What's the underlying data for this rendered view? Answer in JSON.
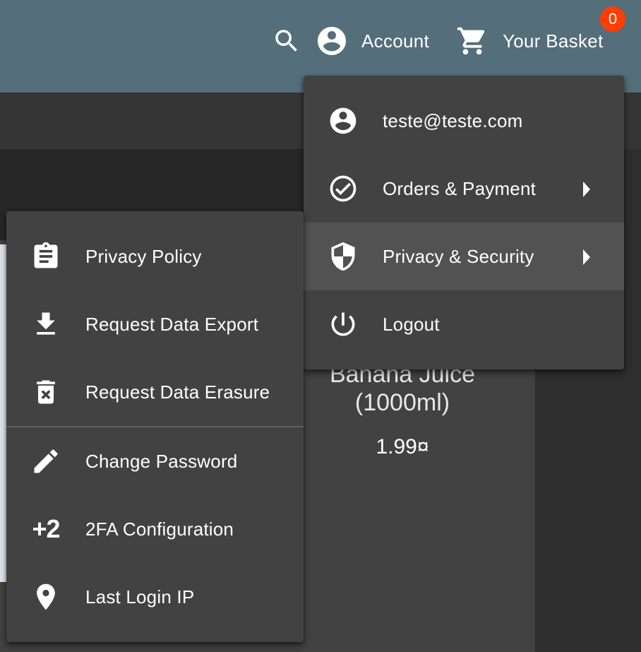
{
  "toolbar": {
    "search_icon": "search-icon",
    "account_label": "Account",
    "basket_label": "Your Basket",
    "basket_count": "0",
    "colors": {
      "toolbar_bg": "#546e7a",
      "badge_bg": "#ff3d00"
    }
  },
  "product": {
    "name_line1": "Banana Juice",
    "name_line2": "(1000ml)",
    "price": "1.99¤"
  },
  "account_menu": {
    "items": [
      {
        "label": "teste@teste.com",
        "icon": "account-circle-icon"
      },
      {
        "label": "Orders & Payment",
        "icon": "check-circle-icon",
        "submenu": true
      },
      {
        "label": "Privacy & Security",
        "icon": "shield-icon",
        "submenu": true,
        "active": true
      },
      {
        "label": "Logout",
        "icon": "power-icon"
      }
    ]
  },
  "privacy_menu": {
    "items": [
      {
        "label": "Privacy Policy",
        "icon": "clipboard-icon"
      },
      {
        "label": "Request Data Export",
        "icon": "download-icon"
      },
      {
        "label": "Request Data Erasure",
        "icon": "delete-icon"
      },
      {
        "label": "Change Password",
        "icon": "pencil-icon"
      },
      {
        "label": "2FA Configuration",
        "icon": "plus-two-icon",
        "icon_text": "+2"
      },
      {
        "label": "Last Login IP",
        "icon": "location-pin-icon"
      }
    ]
  }
}
